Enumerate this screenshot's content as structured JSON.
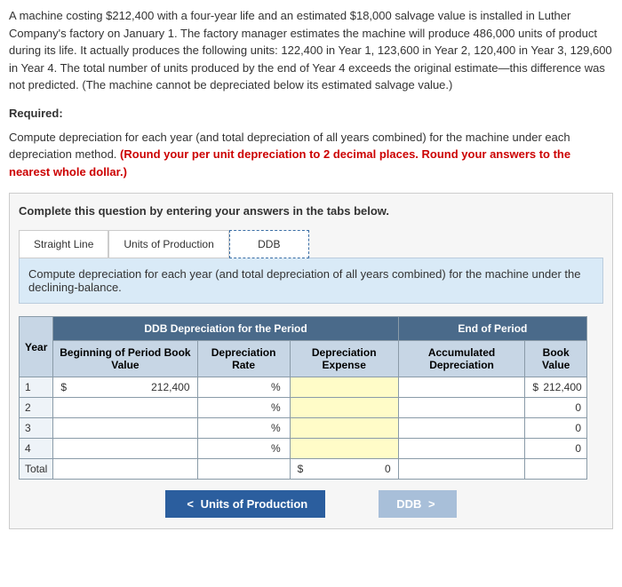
{
  "problem_text": "A machine costing $212,400 with a four-year life and an estimated $18,000 salvage value is installed in Luther Company's factory on January 1. The factory manager estimates the machine will produce 486,000 units of product during its life. It actually produces the following units: 122,400 in Year 1, 123,600 in Year 2, 120,400 in Year 3, 129,600 in Year 4. The total number of units produced by the end of Year 4 exceeds the original estimate—this difference was not predicted. (The machine cannot be depreciated below its estimated salvage value.)",
  "required_label": "Required:",
  "instructions_plain": "Compute depreciation for each year (and total depreciation of all years combined) for the machine under each depreciation method. ",
  "instructions_red": "(Round your per unit depreciation to 2 decimal places. Round your answers to the nearest whole dollar.)",
  "panel_header": "Complete this question by entering your answers in the tabs below.",
  "tabs": {
    "straight": "Straight Line",
    "units": "Units of Production",
    "ddb": "DDB"
  },
  "tab_content_text": "Compute depreciation for each year (and total depreciation of all years combined) for the machine under the declining-balance.",
  "table": {
    "group_period": "DDB Depreciation for the Period",
    "group_end": "End of Period",
    "col_year": "Year",
    "col_beg": "Beginning of Period Book Value",
    "col_rate": "Depreciation Rate",
    "col_exp": "Depreciation Expense",
    "col_accum": "Accumulated Depreciation",
    "col_bv": "Book Value",
    "rows": {
      "r1": "1",
      "r2": "2",
      "r3": "3",
      "r4": "4",
      "total": "Total"
    },
    "beg_y1": "212,400",
    "bv_y1": "212,400",
    "bv_y2": "0",
    "bv_y3": "0",
    "bv_y4": "0",
    "total_exp": "0",
    "dollar": "$",
    "pct": "%"
  },
  "nav": {
    "prev": "Units of Production",
    "next": "DDB",
    "left_chevron": "<",
    "right_chevron": ">"
  }
}
